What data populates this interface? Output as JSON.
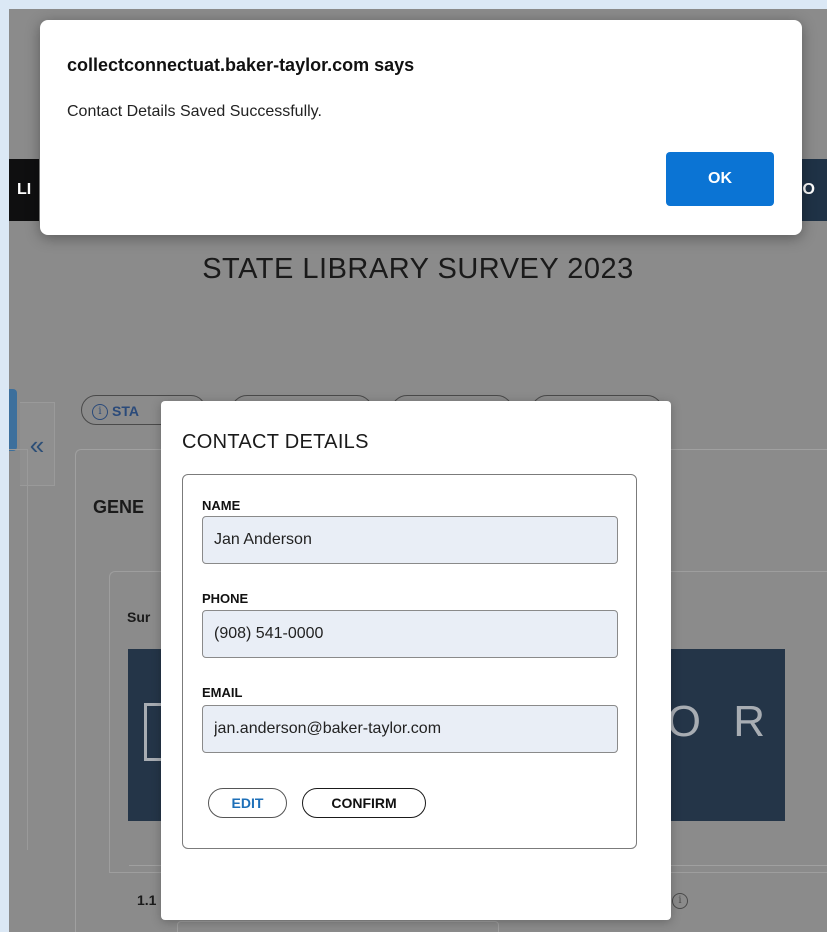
{
  "alert": {
    "title": "collectconnectuat.baker-taylor.com says",
    "message": "Contact Details Saved Successfully.",
    "ok_label": "OK",
    "ok_color": "#0b74d4"
  },
  "nav": {
    "left_partial": "LI",
    "right_partial": "CO"
  },
  "page": {
    "title": "STATE LIBRARY SURVEY 2023",
    "status_tab_partial": "STA",
    "section_partial": "GENE",
    "card_label_partial": "Sur",
    "banner_partial": "L O R",
    "question_number": "1.1",
    "info_glyph": "i",
    "collapse_glyph": "«"
  },
  "modal": {
    "title": "CONTACT DETAILS",
    "fields": {
      "name": {
        "label": "NAME",
        "value": "Jan Anderson"
      },
      "phone": {
        "label": "PHONE",
        "value": "(908) 541-0000"
      },
      "email": {
        "label": "EMAIL",
        "value": "jan.anderson@baker-taylor.com"
      }
    },
    "edit_label": "EDIT",
    "confirm_label": "CONFIRM",
    "edit_color": "#1d6fb8"
  },
  "colors": {
    "overlay": "#8b8b8b",
    "banner": "#243548",
    "field_bg": "#e9eef6"
  },
  "icons": [
    "info-icon",
    "collapse-left-icon"
  ]
}
